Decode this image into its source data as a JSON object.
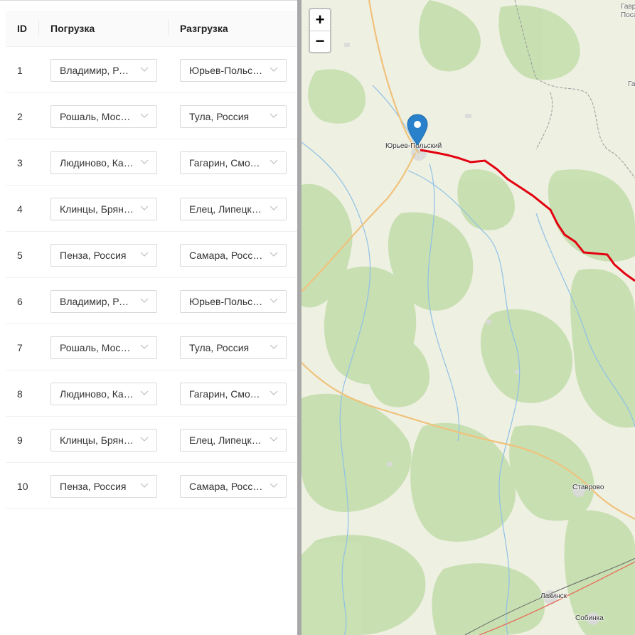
{
  "table": {
    "headers": {
      "id": "ID",
      "load": "Погрузка",
      "unload": "Разгрузка"
    },
    "rows": [
      {
        "id": "1",
        "load": "Владимир, Россия",
        "unload": "Юрьев-Польский, Россия"
      },
      {
        "id": "2",
        "load": "Рошаль, Московская обл.",
        "unload": "Тула, Россия"
      },
      {
        "id": "3",
        "load": "Людиново, Калужская обл.",
        "unload": "Гагарин, Смоленская обл."
      },
      {
        "id": "4",
        "load": "Клинцы, Брянская обл.",
        "unload": "Елец, Липецкая обл."
      },
      {
        "id": "5",
        "load": "Пенза, Россия",
        "unload": "Самара, Россия"
      },
      {
        "id": "6",
        "load": "Владимир, Россия",
        "unload": "Юрьев-Польский, Россия"
      },
      {
        "id": "7",
        "load": "Рошаль, Московская обл.",
        "unload": "Тула, Россия"
      },
      {
        "id": "8",
        "load": "Людиново, Калужская обл.",
        "unload": "Гагарин, Смоленская обл."
      },
      {
        "id": "9",
        "load": "Клинцы, Брянская обл.",
        "unload": "Елец, Липецкая обл."
      },
      {
        "id": "10",
        "load": "Пенза, Россия",
        "unload": "Самара, Россия"
      }
    ]
  },
  "map": {
    "zoom_in": "+",
    "zoom_out": "−",
    "labels": {
      "yuryev": "Юрьев-Польский",
      "stavrovo": "Ставрово",
      "lakinsk": "Лакинск",
      "sobinka": "Собинка",
      "corner_top1": "Гавр",
      "corner_top2": "Поса",
      "corner_mid": "Га"
    },
    "route_color": "#e3000f",
    "marker_color": "#2a81cb"
  }
}
